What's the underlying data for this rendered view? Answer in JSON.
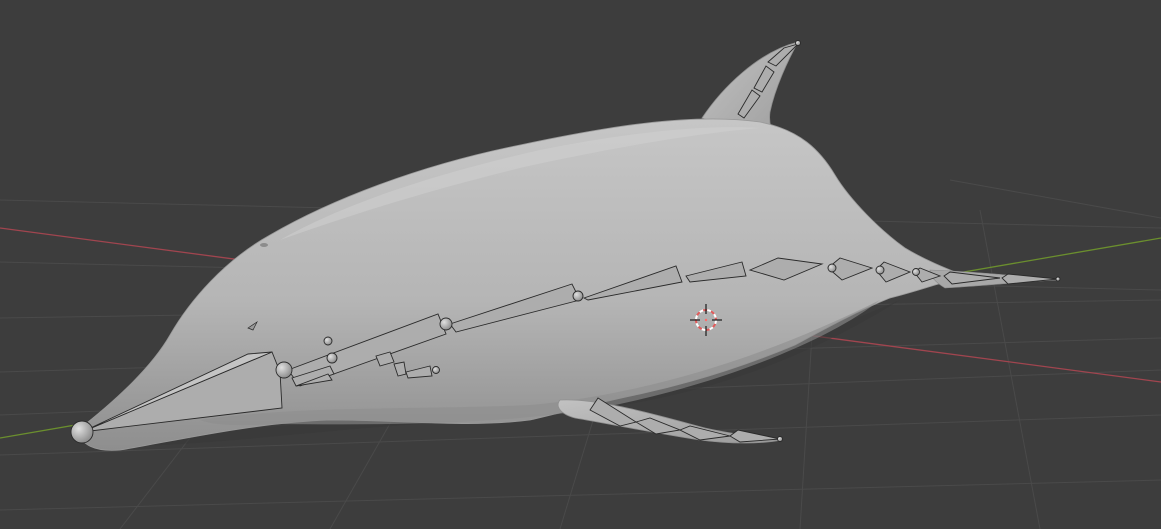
{
  "viewport": {
    "background": "#3d3d3d",
    "grid_color": "#4a4a4a",
    "x_axis_color": "#a1454f",
    "y_axis_color": "#6b8f2e"
  },
  "model": {
    "name": "dolphin-mesh",
    "body_color": "#b9b9b9",
    "shadow_color": "#6e6e6e",
    "highlight_color": "#d0d0d0"
  },
  "armature": {
    "name": "dolphin-armature",
    "bone_color": "#adadad",
    "bone_edge_color": "#2a2a2a",
    "joint_color": "#c4c4c4",
    "bone_count": 24
  },
  "cursor": {
    "name": "3d-cursor",
    "ring_color_a": "#e35a5a",
    "ring_color_b": "#ffffff"
  }
}
